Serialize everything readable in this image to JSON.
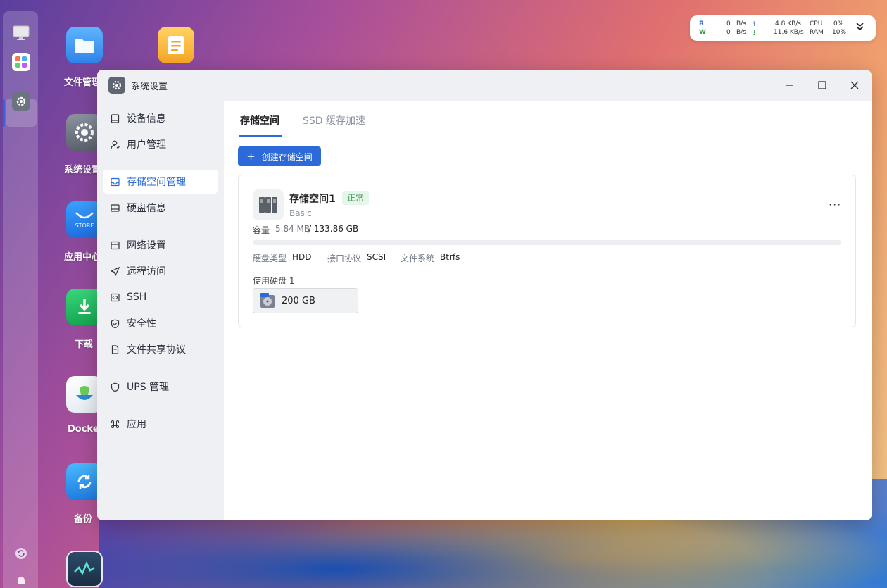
{
  "desktop": {
    "icons": [
      {
        "label": "文件管理"
      },
      {
        "label": "系统设置"
      },
      {
        "label": "应用中心"
      },
      {
        "label": "下载"
      },
      {
        "label": "Docker"
      },
      {
        "label": "备份"
      }
    ],
    "store_text": "STORE"
  },
  "net_widget": {
    "r_label": "R",
    "w_label": "W",
    "r_rate": "0",
    "w_rate": "0",
    "r_unit": "B/s",
    "w_unit": "B/s",
    "up_rate": "4.8 KB/s",
    "down_rate": "11.6 KB/s",
    "cpu_label": "CPU",
    "ram_label": "RAM",
    "cpu_value": "0%",
    "ram_value": "10%"
  },
  "window": {
    "title": "系统设置"
  },
  "sidebar": {
    "items": [
      {
        "label": "设备信息"
      },
      {
        "label": "用户管理"
      },
      {
        "label": "存储空间管理"
      },
      {
        "label": "硬盘信息"
      },
      {
        "label": "网络设置"
      },
      {
        "label": "远程访问"
      },
      {
        "label": "SSH"
      },
      {
        "label": "安全性"
      },
      {
        "label": "文件共享协议"
      },
      {
        "label": "UPS 管理"
      },
      {
        "label": "应用"
      }
    ]
  },
  "tabs": [
    {
      "label": "存储空间"
    },
    {
      "label": "SSD 缓存加速"
    }
  ],
  "create_button": "创建存储空间",
  "pool": {
    "name": "存储空间1",
    "status": "正常",
    "type": "Basic",
    "capacity_label": "容量",
    "capacity_used": "5.84 MB",
    "capacity_total": "/ 133.86 GB",
    "usage_fraction": 4e-05,
    "disk_type_label": "硬盘类型",
    "disk_type": "HDD",
    "interface_label": "接口协议",
    "interface": "SCSI",
    "fs_label": "文件系统",
    "fs": "Btrfs",
    "disks_label": "使用硬盘 1",
    "disk_size": "200 GB",
    "more_icon": "more-horizontal-icon"
  },
  "colors": {
    "accent": "#2b6ad8",
    "status_ok": "#2e9b4c"
  }
}
